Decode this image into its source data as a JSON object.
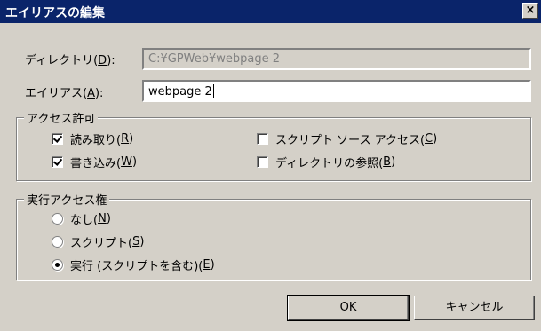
{
  "window": {
    "title": "エイリアスの編集",
    "close_glyph": "×"
  },
  "directory": {
    "label": "ディレクトリ(",
    "accel": "D",
    "suffix": "):",
    "value": "C:¥GPWeb¥webpage 2"
  },
  "alias": {
    "label": "エイリアス(",
    "accel": "A",
    "suffix": "):",
    "value": "webpage 2"
  },
  "access": {
    "legend": "アクセス許可",
    "read": {
      "text": "読み取り(",
      "accel": "R",
      "suffix": ")",
      "checked": true
    },
    "write": {
      "text": "書き込み(",
      "accel": "W",
      "suffix": ")",
      "checked": true
    },
    "script_source": {
      "text": "スクリプト ソース アクセス(",
      "accel": "C",
      "suffix": ")",
      "checked": false
    },
    "browse": {
      "text": "ディレクトリの参照(",
      "accel": "B",
      "suffix": ")",
      "checked": false
    }
  },
  "exec": {
    "legend": "実行アクセス権",
    "none": {
      "text": "なし(",
      "accel": "N",
      "suffix": ")",
      "selected": false
    },
    "scripts": {
      "text": "スクリプト(",
      "accel": "S",
      "suffix": ")",
      "selected": false
    },
    "execute": {
      "text": "実行 (スクリプトを含む)(",
      "accel": "E",
      "suffix": ")",
      "selected": true
    }
  },
  "buttons": {
    "ok": "OK",
    "cancel": "キャンセル"
  },
  "colors": {
    "titlebar": "#0a246a",
    "face": "#d4d0c8"
  }
}
